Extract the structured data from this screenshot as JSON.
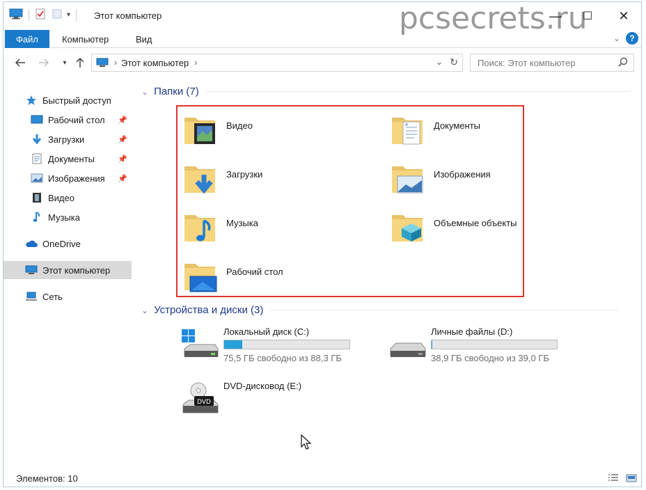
{
  "window": {
    "title": "Этот компьютер",
    "watermark": "pcsecrets.ru",
    "controls": {
      "minimize": "—",
      "maximize": "☐",
      "close": "✕"
    }
  },
  "ribbon": {
    "tabs": [
      "Файл",
      "Компьютер",
      "Вид"
    ],
    "help": "?"
  },
  "address": {
    "segment": "Этот компьютер",
    "search_placeholder": "Поиск: Этот компьютер"
  },
  "sidebar": {
    "items": [
      {
        "label": "Быстрый доступ",
        "icon": "star-icon"
      },
      {
        "label": "Рабочий стол",
        "icon": "desktop-icon",
        "pinned": true
      },
      {
        "label": "Загрузки",
        "icon": "download-icon",
        "pinned": true
      },
      {
        "label": "Документы",
        "icon": "document-icon",
        "pinned": true
      },
      {
        "label": "Изображения",
        "icon": "picture-icon",
        "pinned": true
      },
      {
        "label": "Видео",
        "icon": "video-icon"
      },
      {
        "label": "Музыка",
        "icon": "music-icon"
      },
      {
        "label": "OneDrive",
        "icon": "cloud-icon"
      },
      {
        "label": "Этот компьютер",
        "icon": "computer-icon",
        "selected": true
      },
      {
        "label": "Сеть",
        "icon": "network-icon"
      }
    ]
  },
  "folders": {
    "header": "Папки (7)",
    "items": [
      {
        "label": "Видео",
        "icon": "video-folder-icon"
      },
      {
        "label": "Документы",
        "icon": "documents-folder-icon"
      },
      {
        "label": "Загрузки",
        "icon": "downloads-folder-icon"
      },
      {
        "label": "Изображения",
        "icon": "pictures-folder-icon"
      },
      {
        "label": "Музыка",
        "icon": "music-folder-icon"
      },
      {
        "label": "Объемные объекты",
        "icon": "3d-objects-folder-icon"
      },
      {
        "label": "Рабочий стол",
        "icon": "desktop-folder-icon"
      }
    ]
  },
  "devices": {
    "header": "Устройства и диски (3)",
    "items": [
      {
        "name": "Локальный диск (C:)",
        "free": "75,5 ГБ свободно из 88,3 ГБ",
        "used_fraction": 0.145,
        "icon": "windows-drive-icon"
      },
      {
        "name": "Личные файлы (D:)",
        "free": "38,9 ГБ свободно из 39,0 ГБ",
        "used_fraction": 0.003,
        "icon": "hard-drive-icon"
      },
      {
        "name": "DVD-дисковод (E:)",
        "icon": "dvd-drive-icon",
        "dvd_label": "DVD"
      }
    ]
  },
  "status": {
    "count": "Элементов: 10"
  },
  "colors": {
    "accent": "#1979ca",
    "highlight": "#e0352b",
    "bar": "#26a0da",
    "header_text": "#1e3a8a"
  }
}
